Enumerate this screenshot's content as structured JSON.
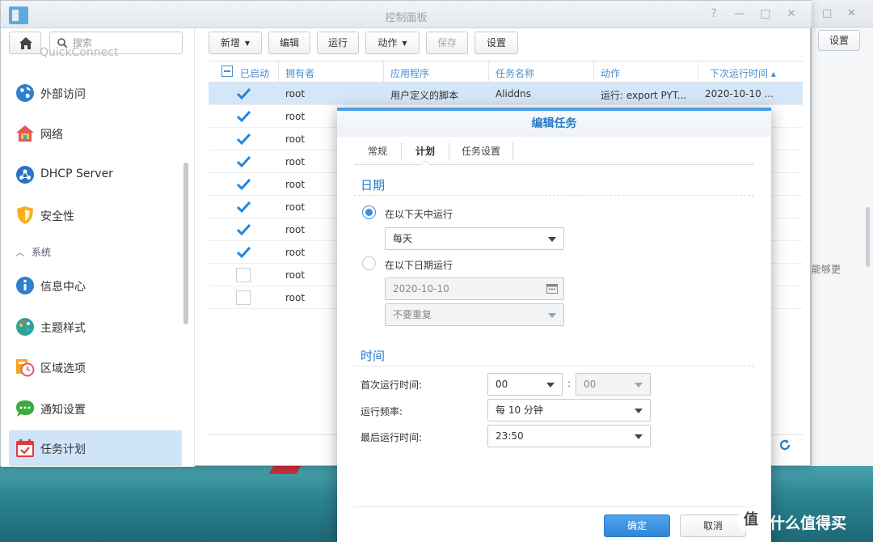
{
  "window": {
    "title": "控制面板",
    "controls": [
      "?",
      "—",
      "□",
      "✕"
    ]
  },
  "back_window": {
    "controls": [
      "□",
      "✕"
    ],
    "settings_button": "设置",
    "hint_text": "能够更"
  },
  "sidebar": {
    "search_placeholder": "搜索",
    "partial_item": "QuickConnect",
    "items": [
      {
        "label": "外部访问",
        "icon": "globe-icon"
      },
      {
        "label": "网络",
        "icon": "home-network-icon"
      },
      {
        "label": "DHCP Server",
        "icon": "dhcp-icon"
      },
      {
        "label": "安全性",
        "icon": "shield-icon"
      }
    ],
    "section": "系统",
    "system_items": [
      {
        "label": "信息中心",
        "icon": "info-icon"
      },
      {
        "label": "主题样式",
        "icon": "palette-icon"
      },
      {
        "label": "区域选项",
        "icon": "clock-icon"
      },
      {
        "label": "通知设置",
        "icon": "chat-icon"
      },
      {
        "label": "任务计划",
        "icon": "calendar-check-icon"
      }
    ]
  },
  "toolbar": {
    "create": "新增",
    "edit": "编辑",
    "run": "运行",
    "action": "动作",
    "save": "保存",
    "settings": "设置"
  },
  "grid": {
    "columns": [
      "已启动",
      "拥有者",
      "应用程序",
      "任务名称",
      "动作",
      "下次运行时间 ▴"
    ],
    "rows": [
      {
        "enabled": true,
        "owner": "root",
        "app": "用户定义的脚本",
        "name": "Aliddns",
        "action": "运行: export PYT...",
        "next": "2020-10-10 ..."
      },
      {
        "enabled": true,
        "owner": "root"
      },
      {
        "enabled": true,
        "owner": "root"
      },
      {
        "enabled": true,
        "owner": "root"
      },
      {
        "enabled": true,
        "owner": "root"
      },
      {
        "enabled": true,
        "owner": "root"
      },
      {
        "enabled": true,
        "owner": "root"
      },
      {
        "enabled": true,
        "owner": "root"
      },
      {
        "enabled": false,
        "owner": "root"
      },
      {
        "enabled": false,
        "owner": "root"
      }
    ]
  },
  "dialog": {
    "title": "编辑任务",
    "tabs": [
      "常规",
      "计划",
      "任务设置"
    ],
    "active_tab": "计划",
    "date_section": "日期",
    "radio_days": "在以下天中运行",
    "days_value": "每天",
    "radio_date": "在以下日期运行",
    "date_value": "2020-10-10",
    "repeat_value": "不要重复",
    "time_section": "时间",
    "first_run_label": "首次运行时间:",
    "first_run_hour": "00",
    "first_run_minute": "00",
    "frequency_label": "运行频率:",
    "frequency_value": "每 10 分钟",
    "last_run_label": "最后运行时间:",
    "last_run_value": "23:50",
    "ok": "确定",
    "cancel": "取消"
  },
  "watermark": {
    "glyph": "值",
    "text": "什么值得买"
  },
  "colors": {
    "accent": "#2a7bc8",
    "selected_row": "#d4e7f9",
    "active_nav": "#cfe4f7"
  }
}
